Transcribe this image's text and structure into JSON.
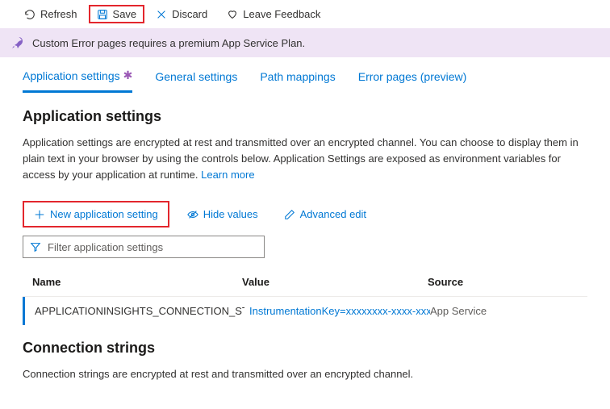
{
  "toolbar": {
    "refresh": "Refresh",
    "save": "Save",
    "discard": "Discard",
    "feedback": "Leave Feedback"
  },
  "banner": {
    "text": "Custom Error pages requires a premium App Service Plan."
  },
  "tabs": {
    "app_settings": "Application settings",
    "general": "General settings",
    "path": "Path mappings",
    "error": "Error pages (preview)"
  },
  "app_settings": {
    "title": "Application settings",
    "desc": "Application settings are encrypted at rest and transmitted over an encrypted channel. You can choose to display them in plain text in your browser by using the controls below. Application Settings are exposed as environment variables for access by your application at runtime. ",
    "learn_more": "Learn more",
    "new_setting": "New application setting",
    "hide_values": "Hide values",
    "advanced_edit": "Advanced edit",
    "filter_placeholder": "Filter application settings",
    "columns": {
      "name": "Name",
      "value": "Value",
      "source": "Source"
    },
    "rows": [
      {
        "name": "APPLICATIONINSIGHTS_CONNECTION_STRING",
        "value": "InstrumentationKey=xxxxxxxx-xxxx-xxxx",
        "source": "App Service"
      }
    ]
  },
  "connection_strings": {
    "title": "Connection strings",
    "desc": "Connection strings are encrypted at rest and transmitted over an encrypted channel."
  }
}
